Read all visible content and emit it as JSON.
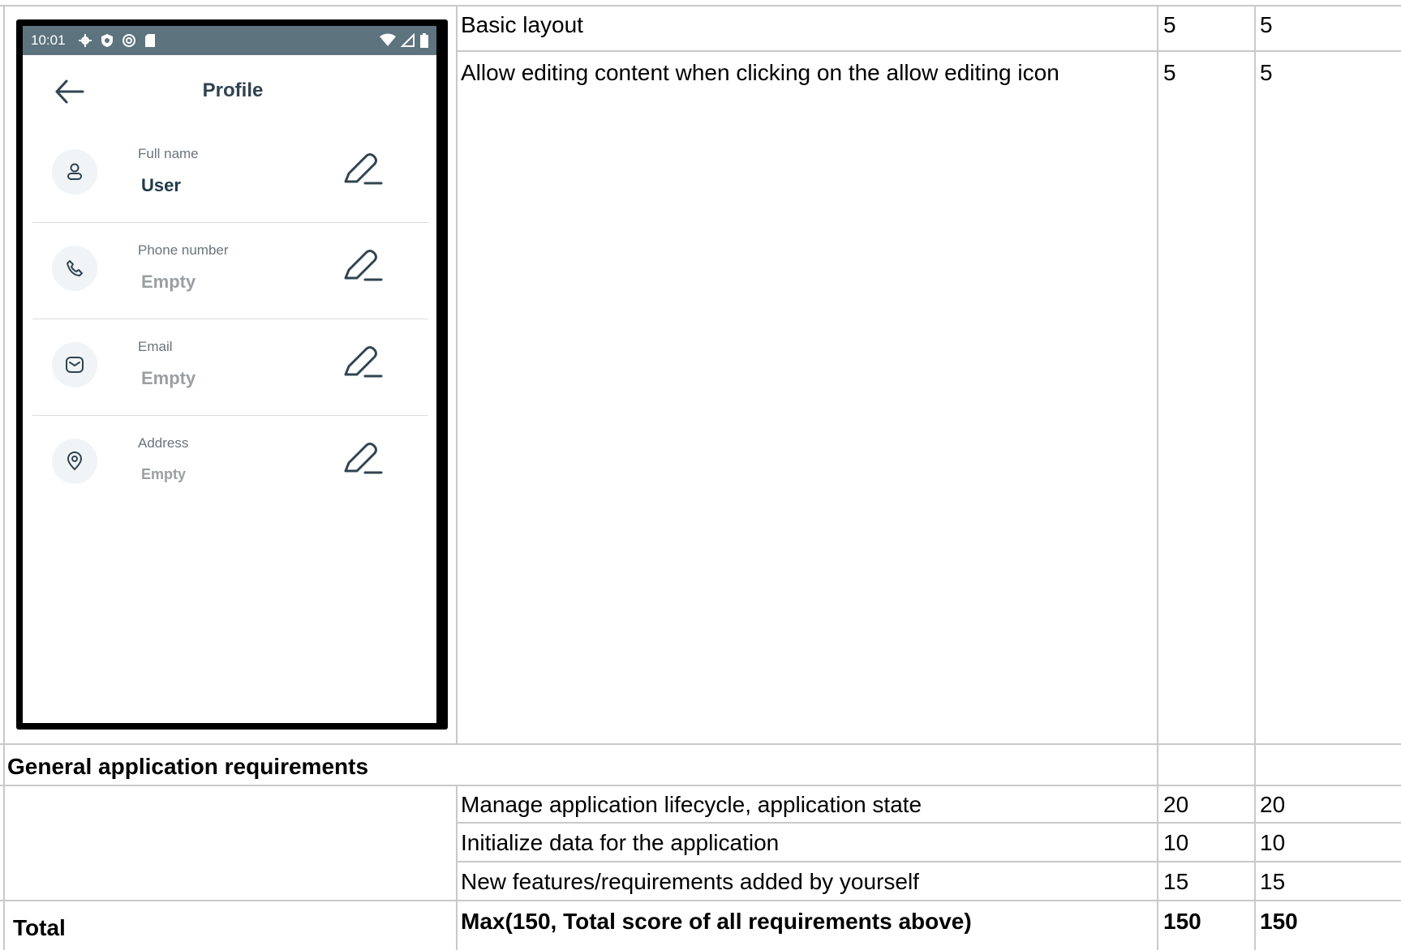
{
  "phone": {
    "status_time": "10:01",
    "title": "Profile",
    "fields": [
      {
        "label": "Full name",
        "value": "User",
        "icon": "user-icon"
      },
      {
        "label": "Phone number",
        "value": "Empty",
        "icon": "phone-icon"
      },
      {
        "label": "Email",
        "value": "Empty",
        "icon": "email-icon"
      },
      {
        "label": "Address",
        "value": "Empty",
        "icon": "location-pin-icon"
      }
    ]
  },
  "table": {
    "rows": [
      {
        "requirement": "Basic layout",
        "score_a": "5",
        "score_b": "5"
      },
      {
        "requirement": "Allow editing content when clicking on the allow editing icon",
        "score_a": "5",
        "score_b": "5"
      }
    ],
    "section_heading": "General application requirements",
    "general_rows": [
      {
        "requirement": "Manage application lifecycle, application state",
        "score_a": "20",
        "score_b": "20"
      },
      {
        "requirement": "Initialize data for the application",
        "score_a": "10",
        "score_b": "10"
      },
      {
        "requirement": "New features/requirements added by yourself",
        "score_a": "15",
        "score_b": "15"
      }
    ],
    "total": {
      "label": "Total",
      "requirement": "Max(150, Total score of all requirements above)",
      "score_a": "150",
      "score_b": "150"
    }
  },
  "colors": {
    "status_bar": "#5d737e",
    "title_text": "#2f4450",
    "grid_line": "#c9c9c9"
  }
}
